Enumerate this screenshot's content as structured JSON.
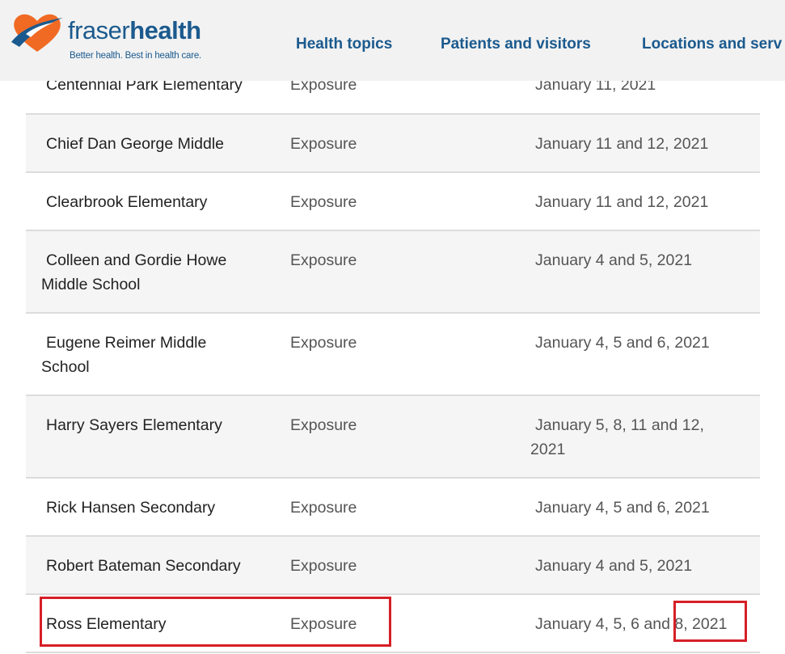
{
  "header": {
    "logo": {
      "word_light": "fraser",
      "word_bold": "health",
      "tagline": "Better health. Best in health care."
    },
    "nav": [
      {
        "label": "Health topics"
      },
      {
        "label": "Patients and visitors"
      },
      {
        "label": "Locations and serv"
      }
    ]
  },
  "colors": {
    "brand_blue": "#1b5a8e",
    "brand_orange": "#f06a24",
    "highlight_red": "#d61f26"
  },
  "table": {
    "rows": [
      {
        "school": "Centennial Park Elementary",
        "type": "Exposure",
        "dates": "January 11, 2021"
      },
      {
        "school": "Chief Dan George Middle",
        "type": "Exposure",
        "dates": "January 11 and 12, 2021"
      },
      {
        "school": "Clearbrook Elementary",
        "type": "Exposure",
        "dates": "January 11 and 12, 2021"
      },
      {
        "school_line1": "Colleen and Gordie Howe",
        "school_line2": "Middle School",
        "type": "Exposure",
        "dates": "January 4 and 5, 2021"
      },
      {
        "school_line1": "Eugene Reimer Middle",
        "school_line2": "School",
        "type": "Exposure",
        "dates": "January 4, 5 and 6, 2021"
      },
      {
        "school": "Harry Sayers Elementary",
        "type": "Exposure",
        "dates_line1": "January 5, 8, 11 and 12,",
        "dates_line2": "2021"
      },
      {
        "school": "Rick Hansen Secondary",
        "type": "Exposure",
        "dates": "January 4, 5 and 6, 2021"
      },
      {
        "school": "Robert Bateman Secondary",
        "type": "Exposure",
        "dates": "January 4 and 5, 2021"
      },
      {
        "school": "Ross Elementary",
        "type": "Exposure",
        "dates": "January 4, 5, 6 and 8, 2021"
      }
    ]
  }
}
